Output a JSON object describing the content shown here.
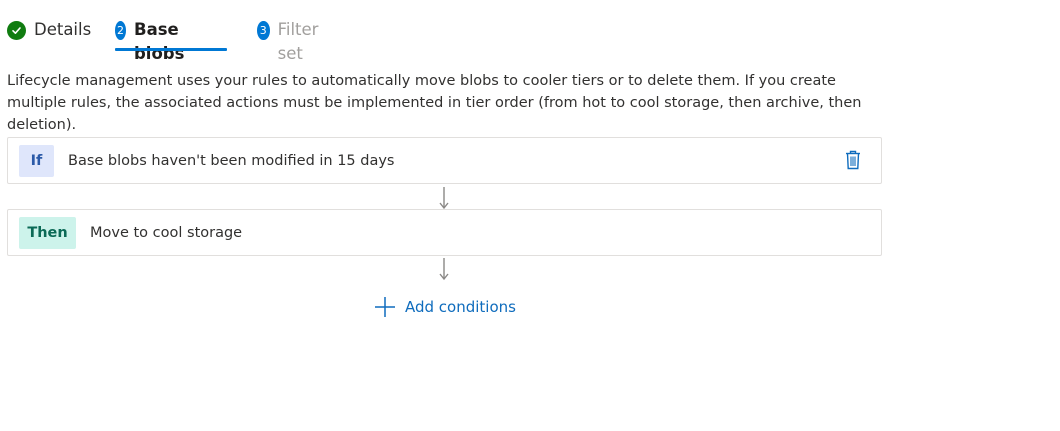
{
  "tabs": [
    {
      "label": "Details",
      "status": "completed",
      "icon": "check-icon"
    },
    {
      "label": "Base blobs",
      "number": "2",
      "status": "active"
    },
    {
      "label": "Filter set",
      "number": "3",
      "status": "inactive"
    }
  ],
  "description": "Lifecycle management uses your rules to automatically move blobs to cooler tiers or to delete them. If you create multiple rules, the associated actions must be implemented in tier order (from hot to cool storage, then archive, then deletion).",
  "rule": {
    "if_tag": "If",
    "if_text": "Base blobs haven't been modified in 15 days",
    "then_tag": "Then",
    "then_text": "Move to cool storage"
  },
  "add_conditions_label": "Add conditions",
  "colors": {
    "accent": "#0078d4",
    "success": "#107c10",
    "if_tag_bg": "#dfe6fb",
    "then_tag_bg": "#cdf3eb"
  }
}
